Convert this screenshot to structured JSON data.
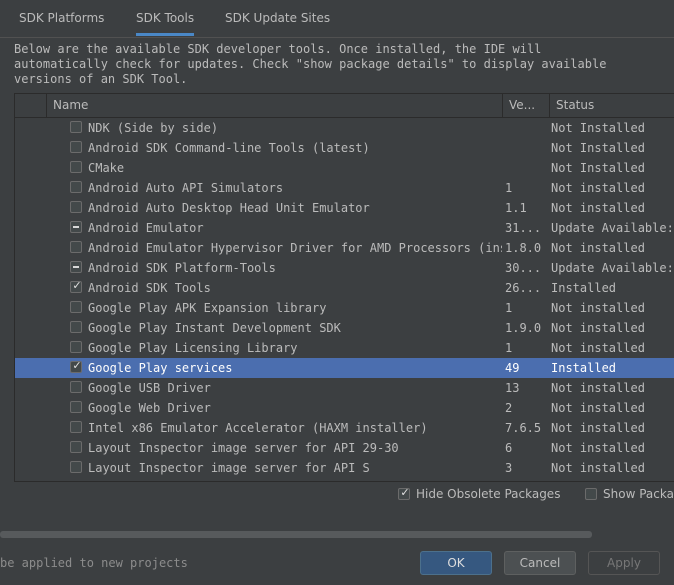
{
  "tabs": [
    {
      "label": "SDK Platforms",
      "active": false
    },
    {
      "label": "SDK Tools",
      "active": true
    },
    {
      "label": "SDK Update Sites",
      "active": false
    }
  ],
  "description": [
    "Below are the available SDK developer tools. Once installed, the IDE will",
    "automatically check for updates. Check \"show package details\" to display available",
    "versions of an SDK Tool."
  ],
  "table": {
    "columns": {
      "name": "Name",
      "version": "Ve...",
      "status": "Status"
    },
    "rows": [
      {
        "name": "NDK (Side by side)",
        "version": "",
        "status": "Not Installed",
        "check": "unchecked",
        "selected": false
      },
      {
        "name": "Android SDK Command-line Tools (latest)",
        "version": "",
        "status": "Not Installed",
        "check": "unchecked",
        "selected": false
      },
      {
        "name": "CMake",
        "version": "",
        "status": "Not Installed",
        "check": "unchecked",
        "selected": false
      },
      {
        "name": "Android Auto API Simulators",
        "version": "1",
        "status": "Not installed",
        "check": "unchecked",
        "selected": false
      },
      {
        "name": "Android Auto Desktop Head Unit Emulator",
        "version": "1.1",
        "status": "Not installed",
        "check": "unchecked",
        "selected": false
      },
      {
        "name": "Android Emulator",
        "version": "31...",
        "status": "Update Available:",
        "check": "partial",
        "selected": false
      },
      {
        "name": "Android Emulator Hypervisor Driver for AMD Processors (inst",
        "version": "1.8.0",
        "status": "Not installed",
        "check": "unchecked",
        "selected": false
      },
      {
        "name": "Android SDK Platform-Tools",
        "version": "30...",
        "status": "Update Available:",
        "check": "partial",
        "selected": false
      },
      {
        "name": "Android SDK Tools",
        "version": "26...",
        "status": "Installed",
        "check": "checked",
        "selected": false
      },
      {
        "name": "Google Play APK Expansion library",
        "version": "1",
        "status": "Not installed",
        "check": "unchecked",
        "selected": false
      },
      {
        "name": "Google Play Instant Development SDK",
        "version": "1.9.0",
        "status": "Not installed",
        "check": "unchecked",
        "selected": false
      },
      {
        "name": "Google Play Licensing Library",
        "version": "1",
        "status": "Not installed",
        "check": "unchecked",
        "selected": false
      },
      {
        "name": "Google Play services",
        "version": "49",
        "status": "Installed",
        "check": "checked",
        "selected": true
      },
      {
        "name": "Google USB Driver",
        "version": "13",
        "status": "Not installed",
        "check": "unchecked",
        "selected": false
      },
      {
        "name": "Google Web Driver",
        "version": "2",
        "status": "Not installed",
        "check": "unchecked",
        "selected": false
      },
      {
        "name": "Intel x86 Emulator Accelerator (HAXM installer)",
        "version": "7.6.5",
        "status": "Not installed",
        "check": "unchecked",
        "selected": false
      },
      {
        "name": "Layout Inspector image server for API 29-30",
        "version": "6",
        "status": "Not installed",
        "check": "unchecked",
        "selected": false
      },
      {
        "name": "Layout Inspector image server for API S",
        "version": "3",
        "status": "Not installed",
        "check": "unchecked",
        "selected": false
      }
    ]
  },
  "options": {
    "hide_obsolete": {
      "label": "Hide Obsolete Packages",
      "checked": true
    },
    "show_details": {
      "label": "Show Packa",
      "checked": false
    }
  },
  "footer": {
    "note": "be applied to new projects",
    "ok_label": "OK",
    "cancel_label": "Cancel",
    "apply_label": "Apply"
  },
  "icons": {
    "checkbox_checked": "check-icon",
    "checkbox_partial": "minus-icon"
  }
}
